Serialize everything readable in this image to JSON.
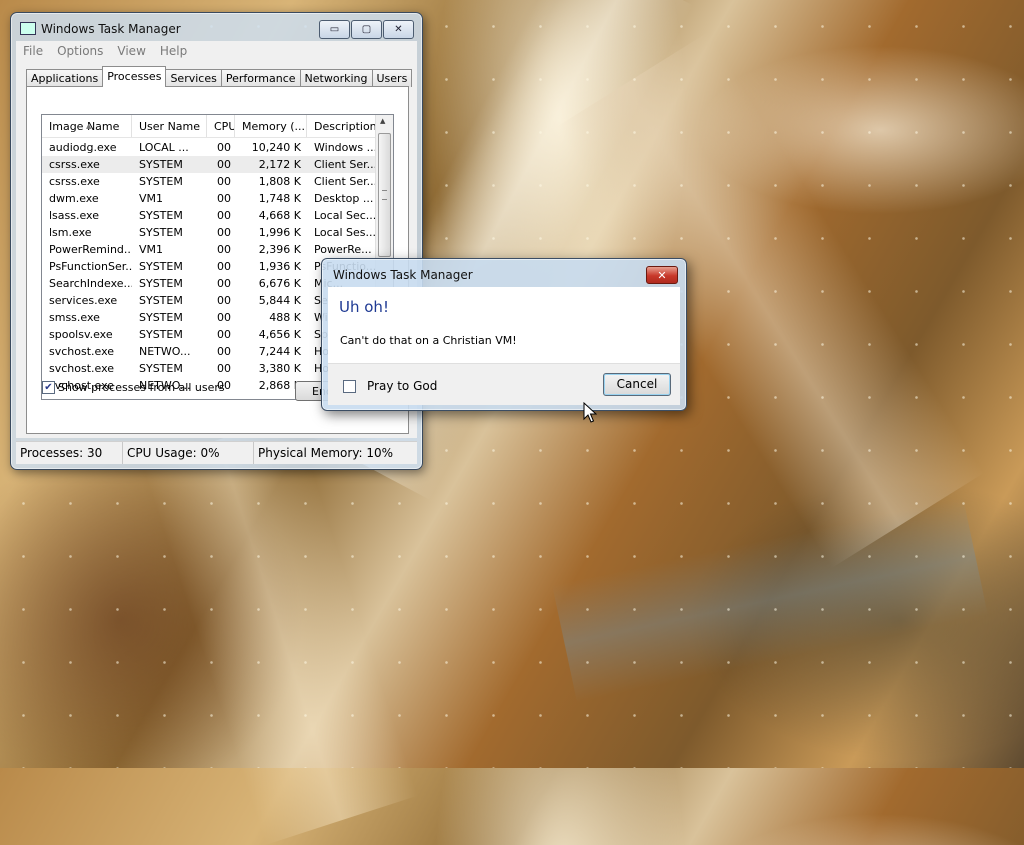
{
  "taskmanager": {
    "title": "Windows Task Manager",
    "caption_buttons": {
      "minimize": "▭",
      "maximize": "▢",
      "close": "✕"
    },
    "menu": [
      "File",
      "Options",
      "View",
      "Help"
    ],
    "tabs": [
      "Applications",
      "Processes",
      "Services",
      "Performance",
      "Networking",
      "Users"
    ],
    "active_tab": "Processes",
    "columns": [
      "Image Name",
      "User Name",
      "CPU",
      "Memory (...",
      "Description"
    ],
    "processes": [
      {
        "image": "audiodg.exe",
        "user": "LOCAL ...",
        "cpu": "00",
        "memory": "10,240 K",
        "description": "Windows ..."
      },
      {
        "image": "csrss.exe",
        "user": "SYSTEM",
        "cpu": "00",
        "memory": "2,172 K",
        "description": "Client Ser..."
      },
      {
        "image": "csrss.exe",
        "user": "SYSTEM",
        "cpu": "00",
        "memory": "1,808 K",
        "description": "Client Ser..."
      },
      {
        "image": "dwm.exe",
        "user": "VM1",
        "cpu": "00",
        "memory": "1,748 K",
        "description": "Desktop ..."
      },
      {
        "image": "lsass.exe",
        "user": "SYSTEM",
        "cpu": "00",
        "memory": "4,668 K",
        "description": "Local Sec..."
      },
      {
        "image": "lsm.exe",
        "user": "SYSTEM",
        "cpu": "00",
        "memory": "1,996 K",
        "description": "Local Ses..."
      },
      {
        "image": "PowerRemind...",
        "user": "VM1",
        "cpu": "00",
        "memory": "2,396 K",
        "description": "PowerRe..."
      },
      {
        "image": "PsFunctionSer...",
        "user": "SYSTEM",
        "cpu": "00",
        "memory": "1,936 K",
        "description": "PsFunctio..."
      },
      {
        "image": "SearchIndexe...",
        "user": "SYSTEM",
        "cpu": "00",
        "memory": "6,676 K",
        "description": "Mic..."
      },
      {
        "image": "services.exe",
        "user": "SYSTEM",
        "cpu": "00",
        "memory": "5,844 K",
        "description": "Ser..."
      },
      {
        "image": "smss.exe",
        "user": "SYSTEM",
        "cpu": "00",
        "memory": "488 K",
        "description": "Win..."
      },
      {
        "image": "spoolsv.exe",
        "user": "SYSTEM",
        "cpu": "00",
        "memory": "4,656 K",
        "description": "Spo..."
      },
      {
        "image": "svchost.exe",
        "user": "NETWO...",
        "cpu": "00",
        "memory": "7,244 K",
        "description": "Hos..."
      },
      {
        "image": "svchost.exe",
        "user": "SYSTEM",
        "cpu": "00",
        "memory": "3,380 K",
        "description": "Hos..."
      },
      {
        "image": "svchost.exe",
        "user": "NETWO...",
        "cpu": "00",
        "memory": "2,868 K",
        "description": "Hos..."
      }
    ],
    "show_all_label": "Show processes from all users",
    "show_all_checked": "✔",
    "end_process_label": "End Process",
    "status": {
      "processes": "Processes: 30",
      "cpu": "CPU Usage: 0%",
      "memory": "Physical Memory: 10%"
    }
  },
  "dialog": {
    "title": "Windows Task Manager",
    "close_glyph": "✕",
    "heading": "Uh oh!",
    "message": "Can't do that on a Christian VM!",
    "checkbox_label": "Pray to God",
    "cancel_label": "Cancel"
  }
}
